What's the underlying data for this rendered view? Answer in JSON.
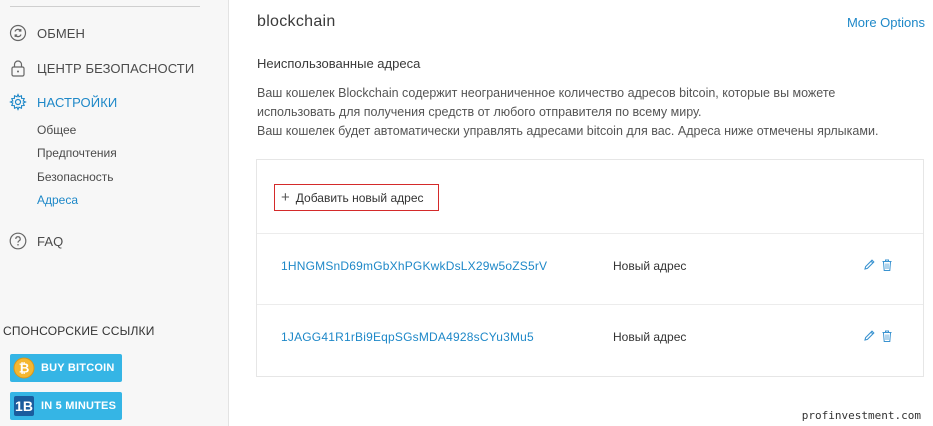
{
  "sidebar": {
    "nav": [
      {
        "label": "ОБМЕН",
        "icon": "exchange-icon"
      },
      {
        "label": "ЦЕНТР БЕЗОПАСНОСТИ",
        "icon": "lock-icon"
      },
      {
        "label": "НАСТРОЙКИ",
        "icon": "gear-icon",
        "active": true
      },
      {
        "label": "FAQ",
        "icon": "question-circle-icon"
      }
    ],
    "settings_sub": [
      "Общее",
      "Предпочтения",
      "Безопасность",
      "Адреса"
    ],
    "active_sub": "Адреса",
    "sponsor_title": "СПОНСОРСКИЕ ССЫЛКИ",
    "sponsors": [
      {
        "label": "BUY BITCOIN",
        "icon": "bitcoin-coin-icon"
      },
      {
        "label": "IN 5 MINUTES",
        "icon": "sponsor-logo-icon"
      }
    ]
  },
  "main": {
    "wallet_title": "blockchain",
    "more_options": "More Options",
    "section_title": "Неиспользованные адреса",
    "description": [
      "Ваш кошелек Blockchain содержит неограниченное количество адресов bitcoin, которые вы можете",
      "использовать для получения средств от любого отправителя по всему миру.",
      "Ваш кошелек будет автоматически управлять адресами bitcoin для вас. Адреса ниже отмечены ярлыками."
    ],
    "add_button": {
      "icon": "plus-icon",
      "label": "Добавить новый адрес"
    },
    "addresses": [
      {
        "address": "1HNGMSnD69mGbXhPGKwkDsLX29w5oZS5rV",
        "label": "Новый адрес"
      },
      {
        "address": "1JAGG41R1rBi9EqpSGsMDA4928sCYu3Mu5",
        "label": "Новый адрес"
      }
    ]
  },
  "watermark": "profinvestment.com",
  "colors": {
    "accent": "#1e88c8",
    "highlight_border": "#d42a2a",
    "sponsor_bg": "#35b5e5",
    "sidebar_bg": "#f7f7f7"
  }
}
